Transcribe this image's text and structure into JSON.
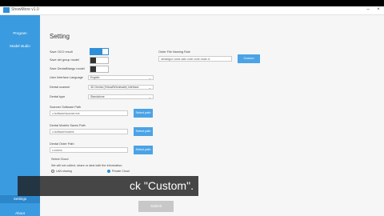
{
  "app": {
    "title": "ShowMore v1.0",
    "window_min": "–",
    "window_close": "×"
  },
  "sidebar": {
    "items": [
      {
        "label": "Program"
      },
      {
        "label": "Model studio"
      },
      {
        "label": "Settings"
      },
      {
        "label": "About"
      }
    ]
  },
  "settings": {
    "title": "Setting",
    "options": [
      {
        "label": "Save OCO result",
        "state": "on"
      },
      {
        "label": "Save del group model",
        "state": "off"
      },
      {
        "label": "Save DentalMango model",
        "state": "off"
      }
    ],
    "language": {
      "label": "User Interface Language",
      "value": "English"
    },
    "dental_scanner": {
      "label": "Dental scanner",
      "value": "3D Dental (Virtual/Wholesale) Interface"
    },
    "dental_type": {
      "label": "Dental type",
      "value": "Standalone"
    },
    "scanner_path": {
      "label": "Scanner Software Path",
      "value": "c:/software/scanner.exe",
      "button": "Select path"
    },
    "models_path": {
      "label": "Dental Models Saves Path",
      "value": "c:/software/models",
      "button": "Select path"
    },
    "order_path": {
      "label": "Dental Order Path",
      "value": "c:/orders",
      "button": "Select path"
    },
    "order_file_naming": {
      "label": "Order File Naming Rule",
      "value": "dentaltype name-date-order code-mode.ix",
      "button": "Custom"
    },
    "cloud": {
      "label": "Select Cloud",
      "description": "We will not collect, share or deal with the information.",
      "options": [
        {
          "label": "LAN sharing",
          "selected": false
        },
        {
          "label": "Private Cloud",
          "selected": true
        }
      ]
    },
    "save_button": "Submit"
  },
  "caption": {
    "text": "ck \"Custom\"."
  }
}
